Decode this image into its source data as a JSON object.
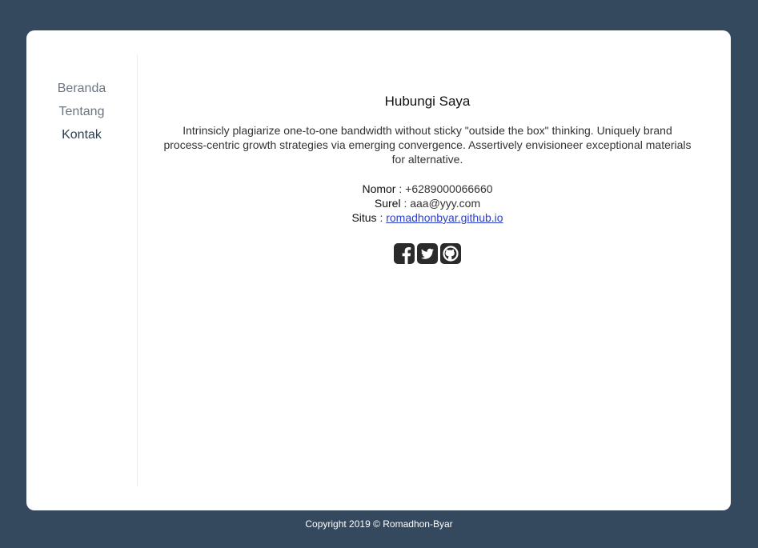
{
  "nav": {
    "items": [
      {
        "label": "Beranda",
        "active": false
      },
      {
        "label": "Tentang",
        "active": false
      },
      {
        "label": "Kontak",
        "active": true
      }
    ]
  },
  "contact": {
    "title": "Hubungi Saya",
    "description": "Intrinsicly plagiarize one-to-one bandwidth without sticky \"outside the box\" thinking. Uniquely brand process-centric growth strategies via emerging convergence. Assertively envisioneer exceptional materials for alternative.",
    "phone_label": "Nomor",
    "phone_value": "+6289000066660",
    "email_label": "Surel",
    "email_value": "aaa@yyy.com",
    "site_label": "Situs",
    "site_value": "romadhonbyar.github.io",
    "separator": ":"
  },
  "socials": [
    {
      "icon": "facebook-icon"
    },
    {
      "icon": "twitter-icon"
    },
    {
      "icon": "github-icon"
    }
  ],
  "footer": {
    "text": "Copyright 2019 © Romadhon-Byar"
  },
  "colors": {
    "background": "#34495e",
    "card": "#ffffff",
    "link": "#2b3fcf"
  }
}
